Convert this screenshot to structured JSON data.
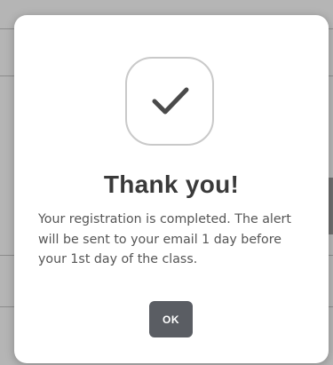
{
  "dialog": {
    "title": "Thank you!",
    "message": "Your registration is completed. The alert will be sent to your email 1 day before your 1st day of the class.",
    "ok_label": "OK"
  },
  "colors": {
    "overlay": "#b5b5b5",
    "dialog_background": "#ffffff",
    "icon_border": "#c9c9c9",
    "checkmark": "#4a4a4a",
    "title_text": "#3a3a3a",
    "body_text": "#555555",
    "button_background": "#5a5d63",
    "button_text": "#ffffff"
  },
  "icons": {
    "success": "checkmark-icon"
  }
}
